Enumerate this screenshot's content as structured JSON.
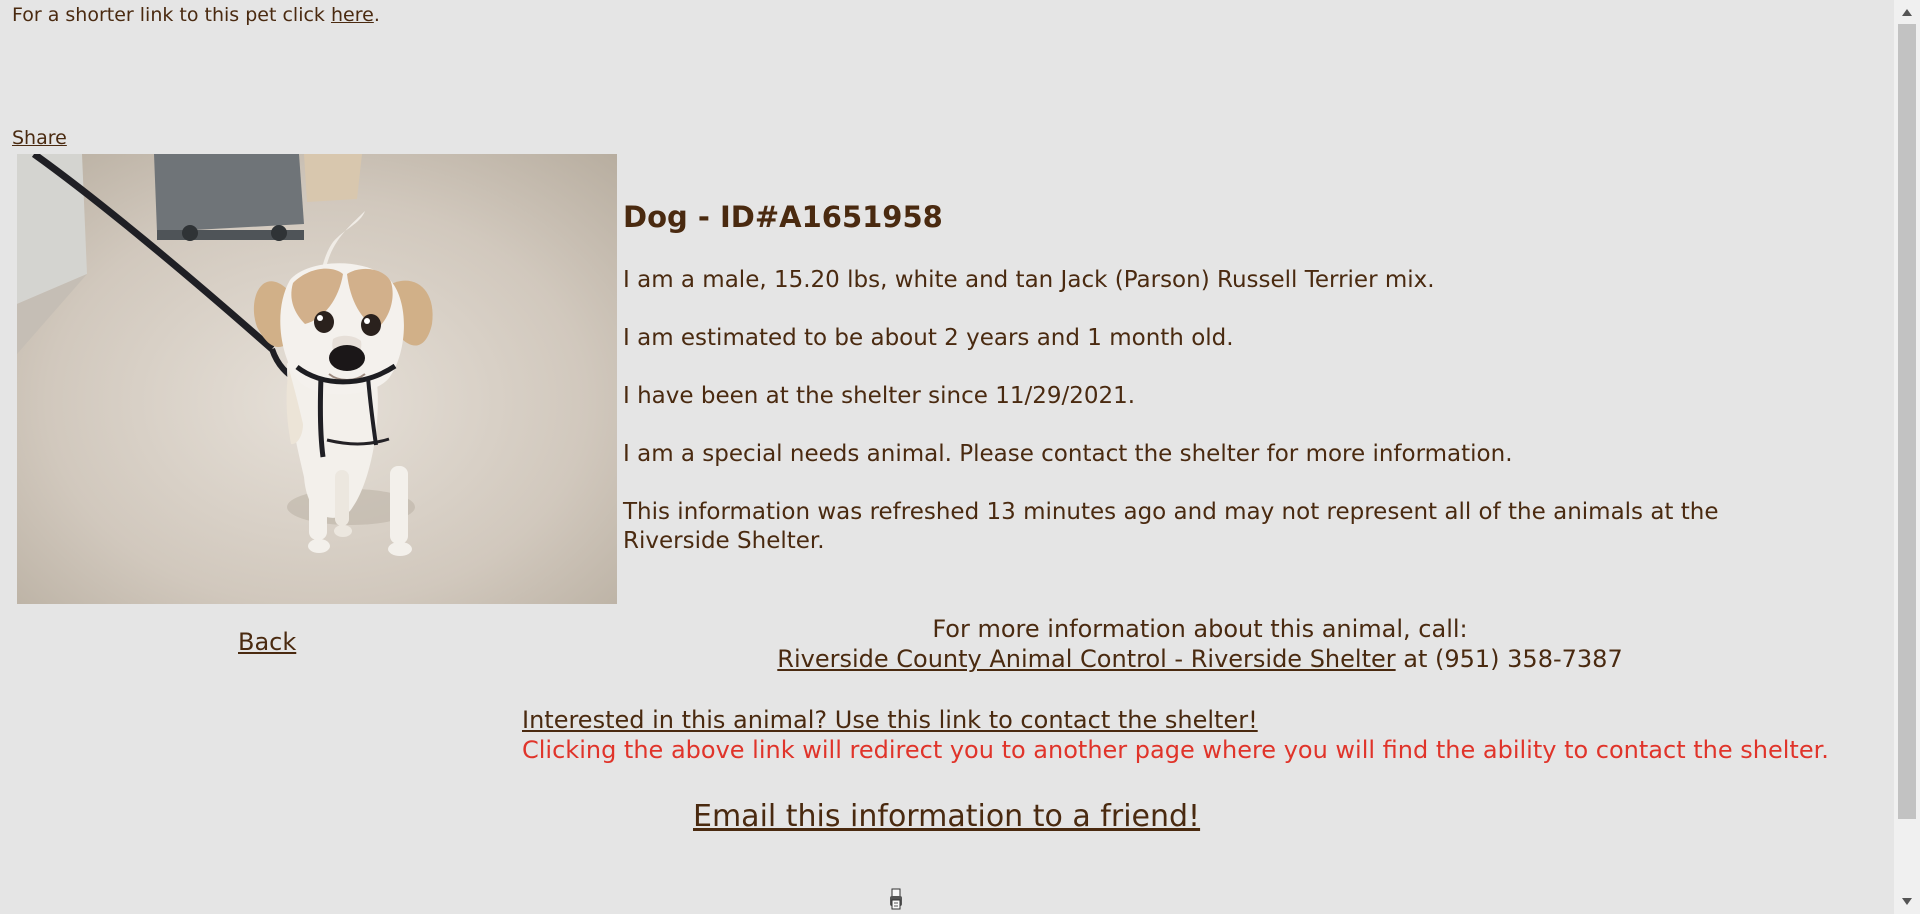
{
  "page": {
    "short_link_text": "For a shorter link to this pet click ",
    "short_link_label": "here",
    "short_link_end": ".",
    "share_label": "Share"
  },
  "animal": {
    "title": "Dog - ID#A1651958",
    "description": "I am a male, 15.20 lbs, white and tan Jack (Parson) Russell Terrier mix.",
    "age": "I am estimated to be about 2 years and 1 month old.",
    "shelter_since": "I have been at the shelter since 11/29/2021.",
    "special_needs": "I am a special needs animal. Please contact the shelter for more information.",
    "refresh_note": "This information was refreshed 13 minutes ago and may not represent all of the animals at the Riverside Shelter."
  },
  "actions": {
    "back_label": "Back",
    "more_info_label": "For more information about this animal, call:",
    "shelter_name": "Riverside County Animal Control - Riverside Shelter",
    "phone_prefix": " at ",
    "phone": "(951) 358-7387",
    "contact_link": "Interested in this animal? Use this link to contact the shelter!",
    "contact_warning": "Clicking the above link will redirect you to another page where you will find the ability to contact the shelter.",
    "email_link": "Email this information to a friend!"
  },
  "colors": {
    "background": "#e5e5e5",
    "text": "#4a2a10",
    "warning": "#e0342a"
  },
  "icons": {
    "bottom_icon": "printer-icon",
    "scroll_up": "arrow-up-icon",
    "scroll_down": "arrow-down-icon"
  }
}
